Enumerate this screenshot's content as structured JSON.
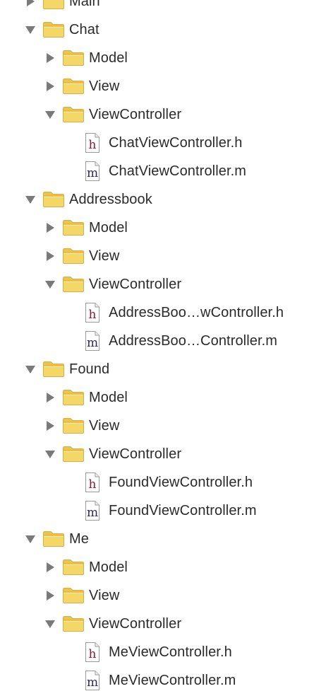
{
  "colors": {
    "folder_fill": "#F5D768",
    "folder_tab": "#E9C54E",
    "folder_stroke": "#D9AE3A",
    "disclosure": "#7A7A7A",
    "header_file_letter": "#8B1E2D",
    "impl_file_letter": "#2E2A5A",
    "text": "#2B2B2B"
  },
  "tree": [
    {
      "label": "Main",
      "expanded": false,
      "children": []
    },
    {
      "label": "Chat",
      "expanded": true,
      "children": [
        {
          "label": "Model",
          "expanded": false
        },
        {
          "label": "View",
          "expanded": false
        },
        {
          "label": "ViewController",
          "expanded": true,
          "files": [
            {
              "label": "ChatViewController.h",
              "kind": "h",
              "icon": "header-file-icon"
            },
            {
              "label": "ChatViewController.m",
              "kind": "m",
              "icon": "implementation-file-icon"
            }
          ]
        }
      ]
    },
    {
      "label": "Addressbook",
      "expanded": true,
      "children": [
        {
          "label": "Model",
          "expanded": false
        },
        {
          "label": "View",
          "expanded": false
        },
        {
          "label": "ViewController",
          "expanded": true,
          "files": [
            {
              "label": "AddressBoo…wController.h",
              "kind": "h",
              "icon": "header-file-icon"
            },
            {
              "label": "AddressBoo…Controller.m",
              "kind": "m",
              "icon": "implementation-file-icon"
            }
          ]
        }
      ]
    },
    {
      "label": "Found",
      "expanded": true,
      "children": [
        {
          "label": "Model",
          "expanded": false
        },
        {
          "label": "View",
          "expanded": false
        },
        {
          "label": "ViewController",
          "expanded": true,
          "files": [
            {
              "label": "FoundViewController.h",
              "kind": "h",
              "icon": "header-file-icon"
            },
            {
              "label": "FoundViewController.m",
              "kind": "m",
              "icon": "implementation-file-icon"
            }
          ]
        }
      ]
    },
    {
      "label": "Me",
      "expanded": true,
      "children": [
        {
          "label": "Model",
          "expanded": false
        },
        {
          "label": "View",
          "expanded": false
        },
        {
          "label": "ViewController",
          "expanded": true,
          "files": [
            {
              "label": "MeViewController.h",
              "kind": "h",
              "icon": "header-file-icon"
            },
            {
              "label": "MeViewController.m",
              "kind": "m",
              "icon": "implementation-file-icon"
            }
          ]
        }
      ]
    }
  ]
}
